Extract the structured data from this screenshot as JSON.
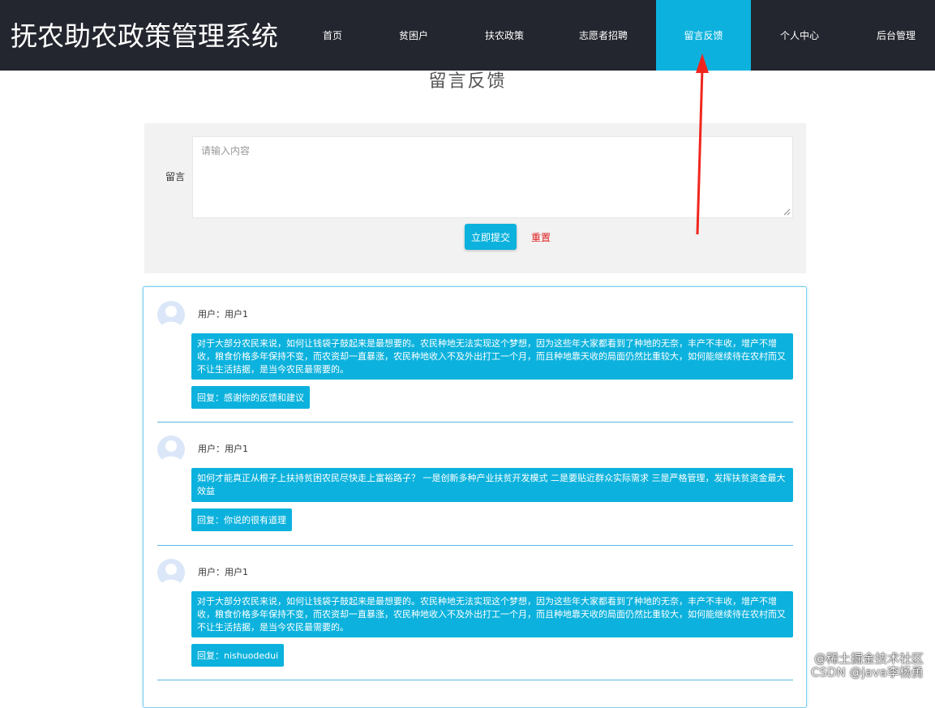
{
  "header": {
    "brand": "抚农助农政策管理系统",
    "nav": [
      {
        "label": "首页"
      },
      {
        "label": "贫困户"
      },
      {
        "label": "扶农政策"
      },
      {
        "label": "志愿者招聘"
      },
      {
        "label": "留言反馈",
        "active": true
      },
      {
        "label": "个人中心"
      },
      {
        "label": "后台管理"
      }
    ]
  },
  "page": {
    "title": "留言反馈"
  },
  "form": {
    "label": "留言",
    "placeholder": "请输入内容",
    "value": "",
    "submit_label": "立即提交",
    "reset_label": "重置"
  },
  "messages": [
    {
      "user": "用户：用户1",
      "content": "对于大部分农民来说，如何让钱袋子鼓起来是最想要的。农民种地无法实现这个梦想，因为这些年大家都看到了种地的无奈，丰产不丰收，增产不增收，粮食价格多年保持不变，而农资却一直暴涨，农民种地收入不及外出打工一个月，而且种地靠天收的局面仍然比重较大，如何能继续待在农村而又不让生活拮据，是当今农民最需要的。",
      "reply": "回复：感谢你的反馈和建议"
    },
    {
      "user": "用户：用户1",
      "content": "如何才能真正从根子上扶持贫困农民尽快走上富裕路子？ 一是创新多种产业扶贫开发模式 二是要贴近群众实际需求 三是严格管理，发挥扶贫资金最大效益",
      "reply": "回复：你说的很有道理"
    },
    {
      "user": "用户：用户1",
      "content": "对于大部分农民来说，如何让钱袋子鼓起来是最想要的。农民种地无法实现这个梦想，因为这些年大家都看到了种地的无奈，丰产不丰收，增产不增收，粮食价格多年保持不变，而农资却一直暴涨，农民种地收入不及外出打工一个月，而且种地靠天收的局面仍然比重较大，如何能继续待在农村而又不让生活拮据，是当今农民最需要的。",
      "reply": "回复：nishuodedui"
    }
  ],
  "watermark": {
    "line1": "@稀土掘金技术社区",
    "line2": "CSDN @java李杨勇"
  },
  "colors": {
    "header_bg": "#23262e",
    "accent": "#0cb2dd",
    "reset_text": "#e02020",
    "annotation_arrow": "#f0261e"
  }
}
